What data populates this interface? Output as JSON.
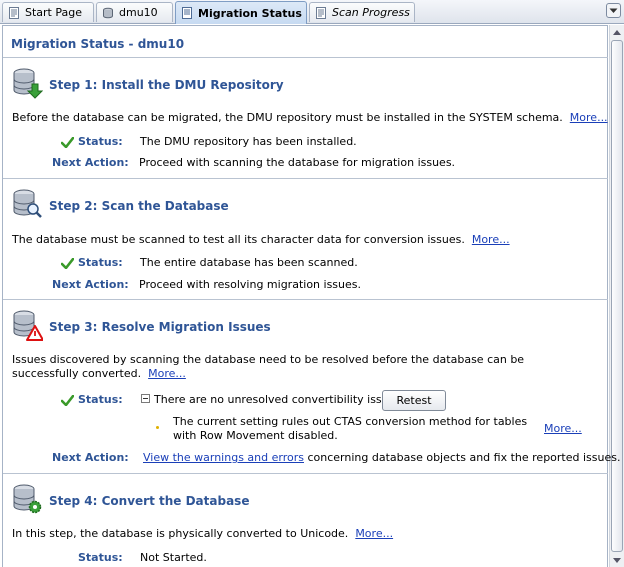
{
  "tabs": [
    {
      "label": "Start Page",
      "icon": "start-page-icon"
    },
    {
      "label": "dmu10",
      "icon": "database-icon"
    },
    {
      "label": "Migration Status",
      "icon": "migration-status-icon",
      "active": true
    },
    {
      "label": "Scan Progress",
      "icon": "scan-progress-icon"
    }
  ],
  "page_title": "Migration Status - dmu10",
  "labels": {
    "status": "Status:",
    "next_action": "Next Action:",
    "more": "More...",
    "retest": "Retest"
  },
  "steps": [
    {
      "title": "Step 1: Install the DMU Repository",
      "description": "Before the database can be migrated, the DMU repository must be installed in the SYSTEM schema.",
      "status": "The DMU repository has been installed.",
      "next_action": "Proceed with scanning the database for migration issues."
    },
    {
      "title": "Step 2: Scan the Database",
      "description": "The database must be scanned to test all its character data for conversion issues.",
      "status": "The entire database has been scanned.",
      "next_action": "Proceed with resolving migration issues."
    },
    {
      "title": "Step 3: Resolve Migration Issues",
      "description": "Issues discovered by scanning the database need to be resolved before the database can be successfully converted.",
      "status": "There are no unresolved convertibility issues.",
      "note": "The current setting rules out CTAS conversion method for tables with Row Movement disabled.",
      "next_action_link": "View the warnings and errors",
      "next_action_rest": " concerning database objects and fix the reported issues."
    },
    {
      "title": "Step 4: Convert the Database",
      "description": "In this step, the database is physically converted to Unicode.",
      "status": "Not Started."
    }
  ],
  "colors": {
    "heading": "#2f5596",
    "link": "#1a3fb8",
    "check": "#3a9a2a"
  }
}
